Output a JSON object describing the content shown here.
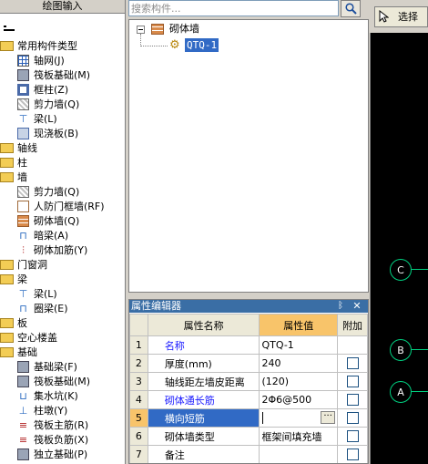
{
  "left_panel": {
    "header": "绘图输入",
    "tree": [
      {
        "kind": "cat",
        "label": "常用构件类型"
      },
      {
        "kind": "item",
        "icon": "ic-grid",
        "label": "轴网(J)"
      },
      {
        "kind": "item",
        "icon": "ic-found",
        "label": "筏板基础(M)"
      },
      {
        "kind": "item",
        "icon": "ic-col",
        "label": "框柱(Z)"
      },
      {
        "kind": "item",
        "icon": "ic-wall",
        "label": "剪力墙(Q)"
      },
      {
        "kind": "item",
        "icon": "ic-beam",
        "glyph": "⊤",
        "label": "梁(L)"
      },
      {
        "kind": "item",
        "icon": "ic-slab",
        "label": "现浇板(B)"
      },
      {
        "kind": "cat",
        "label": "轴线"
      },
      {
        "kind": "cat",
        "label": "柱"
      },
      {
        "kind": "cat",
        "label": "墙"
      },
      {
        "kind": "item",
        "icon": "ic-wall",
        "label": "剪力墙(Q)"
      },
      {
        "kind": "item",
        "icon": "ic-door",
        "label": "人防门框墙(RF)"
      },
      {
        "kind": "item",
        "icon": "ic-brick",
        "label": "砌体墙(Q)",
        "selected": true
      },
      {
        "kind": "item",
        "icon": "ic-beam",
        "glyph": "⊓",
        "label": "暗梁(A)"
      },
      {
        "kind": "item",
        "icon": "ic-rebar",
        "glyph": "⫶",
        "label": "砌体加筋(Y)"
      },
      {
        "kind": "cat",
        "label": "门窗洞"
      },
      {
        "kind": "cat",
        "label": "梁"
      },
      {
        "kind": "item",
        "icon": "ic-beam",
        "glyph": "⊤",
        "label": "梁(L)"
      },
      {
        "kind": "item",
        "icon": "ic-beam",
        "glyph": "⊓",
        "label": "圈梁(E)"
      },
      {
        "kind": "cat",
        "label": "板"
      },
      {
        "kind": "cat",
        "label": "空心楼盖"
      },
      {
        "kind": "cat",
        "label": "基础"
      },
      {
        "kind": "item",
        "icon": "ic-found",
        "label": "基础梁(F)"
      },
      {
        "kind": "item",
        "icon": "ic-found",
        "label": "筏板基础(M)"
      },
      {
        "kind": "item",
        "icon": "ic-pit",
        "glyph": "⊔",
        "label": "集水坑(K)"
      },
      {
        "kind": "item",
        "icon": "ic-pit",
        "glyph": "⊥",
        "label": "柱墩(Y)"
      },
      {
        "kind": "item",
        "icon": "ic-rebar",
        "glyph": "≡",
        "label": "筏板主筋(R)"
      },
      {
        "kind": "item",
        "icon": "ic-rebar",
        "glyph": "≡",
        "label": "筏板负筋(X)"
      },
      {
        "kind": "item",
        "icon": "ic-found",
        "label": "独立基础(P)"
      }
    ]
  },
  "search": {
    "placeholder": "搜索构件..."
  },
  "component_tree": {
    "root_label": "砌体墙",
    "child_label": "QTQ-1"
  },
  "property_editor": {
    "title": "属性编辑器",
    "pin_glyph": "ᛒ",
    "close_glyph": "✕",
    "columns": {
      "name": "属性名称",
      "value": "属性值",
      "extra": "附加"
    },
    "rows": [
      {
        "num": "1",
        "name": "名称",
        "value": "QTQ-1",
        "blue": true,
        "checkbox": false
      },
      {
        "num": "2",
        "name": "厚度(mm)",
        "value": "240",
        "blue": false,
        "checkbox": true
      },
      {
        "num": "3",
        "name": "轴线距左墙皮距离",
        "value": "(120)",
        "blue": false,
        "checkbox": true
      },
      {
        "num": "4",
        "name": "砌体通长筋",
        "value": "2Φ6@500",
        "blue": true,
        "checkbox": true
      },
      {
        "num": "5",
        "name": "横向短筋",
        "value": "",
        "blue": true,
        "checkbox": true,
        "active": true
      },
      {
        "num": "6",
        "name": "砌体墙类型",
        "value": "框架间填充墙",
        "blue": false,
        "checkbox": true
      },
      {
        "num": "7",
        "name": "备注",
        "value": "",
        "blue": false,
        "checkbox": true
      }
    ],
    "ellipsis": "···"
  },
  "toolbar": {
    "select_label": "选择"
  },
  "canvas": {
    "axes": [
      {
        "label": "C"
      },
      {
        "label": "B"
      },
      {
        "label": "A"
      }
    ]
  },
  "colors": {
    "selection": "#316ac5",
    "panel_title": "#3a6ea5",
    "axis": "#00d080",
    "value_header": "#f8c46a"
  }
}
